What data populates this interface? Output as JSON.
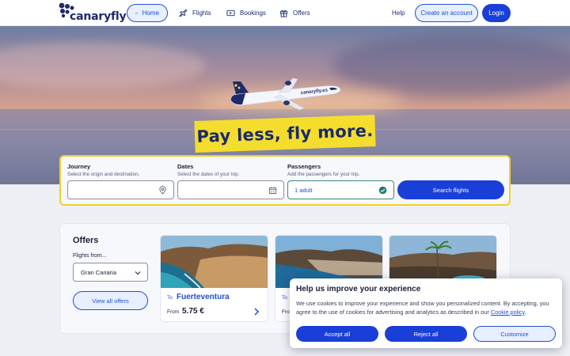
{
  "header": {
    "brand": "canaryfly",
    "nav": [
      {
        "label": "Home",
        "icon": "home-icon"
      },
      {
        "label": "Flights",
        "icon": "plane-icon"
      },
      {
        "label": "Bookings",
        "icon": "ticket-icon"
      },
      {
        "label": "Offers",
        "icon": "gift-icon"
      }
    ],
    "help": "Help",
    "create_account": "Create an account",
    "login": "Login"
  },
  "hero": {
    "slogan": "Pay less, fly more.",
    "plane_livery": "canaryfly.es"
  },
  "search": {
    "journey": {
      "title": "Journey",
      "subtitle": "Select the origin and destination.",
      "value": ""
    },
    "dates": {
      "title": "Dates",
      "subtitle": "Select the dates of your trip.",
      "value": ""
    },
    "passengers": {
      "title": "Passengers",
      "subtitle": "Add the passengers for your trip.",
      "value": "1 adult"
    },
    "button": "Search flights"
  },
  "offers": {
    "title": "Offers",
    "from_label": "Flights from...",
    "from_value": "Gran Canaria",
    "view_all": "View all offers",
    "cards": [
      {
        "to_label": "To",
        "destination": "Fuerteventura",
        "from_label": "From",
        "price": "5.75 €"
      },
      {
        "to_label": "To",
        "destination": "",
        "from_label": "Fro",
        "price": ""
      },
      {
        "to_label": "",
        "destination": "",
        "from_label": "",
        "price": ""
      }
    ]
  },
  "cookie": {
    "title": "Help us improve your experience",
    "text": "We use cookies to improve your experience and show you personalized content. By accepting, you agree to the use of cookies for advertising and analytics as described in our",
    "link": "Cookie policy",
    "accept": "Accept all",
    "reject": "Reject all",
    "customize": "Customize"
  },
  "colors": {
    "primary": "#1a3fd8",
    "brand_dark": "#1f2a6b",
    "accent_yellow": "#f5dd2e"
  }
}
